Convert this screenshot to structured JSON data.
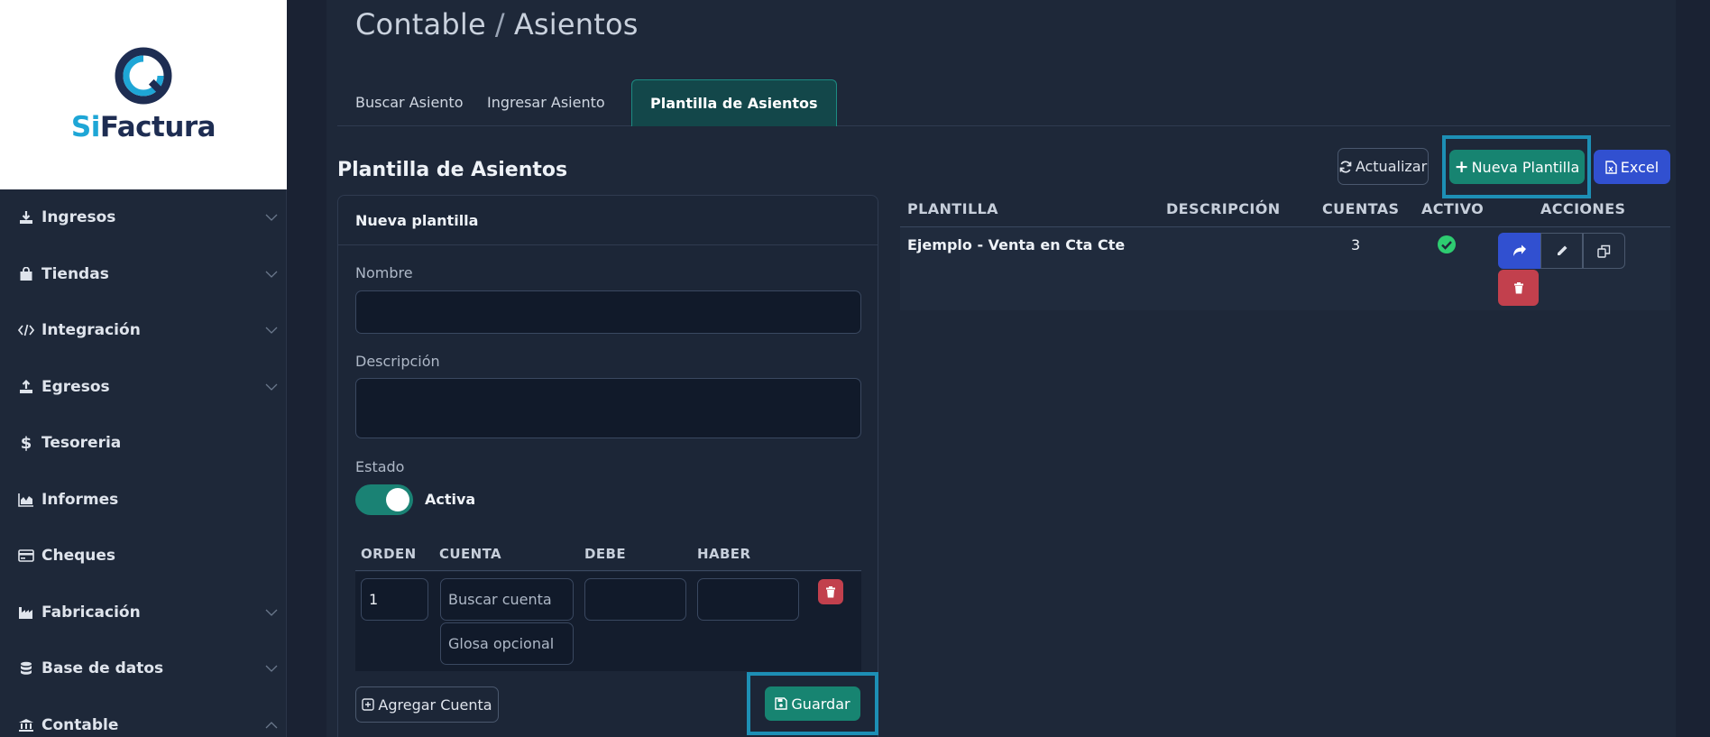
{
  "brand": {
    "logo_si": "Si",
    "logo_factura": "Factura",
    "accent": "#1ea6d6",
    "navy": "#1e2d52"
  },
  "sidebar": {
    "items": [
      {
        "label": "Ingresos",
        "icon": "download-icon",
        "expandable": true
      },
      {
        "label": "Tiendas",
        "icon": "shopping-bag-icon",
        "expandable": true
      },
      {
        "label": "Integración",
        "icon": "code-icon",
        "expandable": true
      },
      {
        "label": "Egresos",
        "icon": "upload-icon",
        "expandable": true
      },
      {
        "label": "Tesoreria",
        "icon": "dollar-icon",
        "expandable": false
      },
      {
        "label": "Informes",
        "icon": "area-chart-icon",
        "expandable": false
      },
      {
        "label": "Cheques",
        "icon": "credit-card-icon",
        "expandable": false
      },
      {
        "label": "Fabricación",
        "icon": "industry-icon",
        "expandable": true
      },
      {
        "label": "Base de datos",
        "icon": "database-icon",
        "expandable": true
      },
      {
        "label": "Contable",
        "icon": "bank-icon",
        "expandable": true,
        "expanded": true
      }
    ]
  },
  "header": {
    "crumb_1": "Contable",
    "separator": "/",
    "crumb_2": "Asientos"
  },
  "tabs": [
    {
      "label": "Buscar Asiento"
    },
    {
      "label": "Ingresar Asiento"
    },
    {
      "label": "Plantilla de Asientos",
      "active": true
    }
  ],
  "section_title": "Plantilla de Asientos",
  "toolbar": {
    "refresh": "Actualizar",
    "new_template": "Nueva Plantilla",
    "excel": "Excel"
  },
  "form": {
    "title": "Nueva plantilla",
    "name_label": "Nombre",
    "name_value": "",
    "desc_label": "Descripción",
    "desc_value": "",
    "status_label": "Estado",
    "status_value": "Activa",
    "accounts_columns": [
      "ORDEN",
      "CUENTA",
      "DEBE",
      "HABER"
    ],
    "account_row": {
      "order": "1",
      "account_placeholder": "Buscar cuenta",
      "gloss_placeholder": "Glosa opcional",
      "debe": "",
      "haber": ""
    },
    "add_account": "Agregar Cuenta",
    "save": "Guardar"
  },
  "table": {
    "columns": [
      "PLANTILLA",
      "DESCRIPCIÓN",
      "CUENTAS",
      "ACTIVO",
      "ACCIONES"
    ],
    "rows": [
      {
        "name": "Ejemplo - Venta en Cta Cte",
        "description": "",
        "accounts": "3",
        "active": true
      }
    ]
  },
  "colors": {
    "teal": "#178471",
    "blue": "#3150d0",
    "red": "#c2404d",
    "green_check": "#2ecc71",
    "highlight": "#1d8fb5"
  }
}
